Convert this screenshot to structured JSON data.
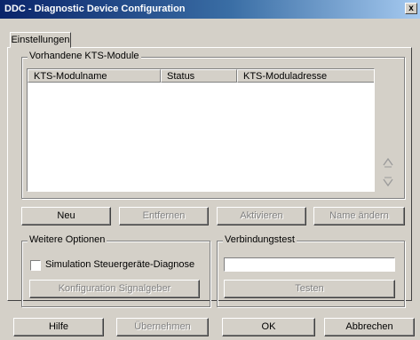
{
  "window": {
    "title": "DDC - Diagnostic Device Configuration",
    "close_label": "x"
  },
  "tabs": [
    {
      "label": "Einstellungen"
    }
  ],
  "modules_group": {
    "label": "Vorhandene KTS-Module",
    "columns": [
      "KTS-Modulname",
      "Status",
      "KTS-Moduladresse"
    ],
    "rows": []
  },
  "module_buttons": {
    "new": "Neu",
    "remove": "Entfernen",
    "activate": "Aktivieren",
    "rename": "Name ändern"
  },
  "options_group": {
    "label": "Weitere Optionen",
    "checkbox_label": "Simulation Steuergeräte-Diagnose",
    "checkbox_checked": false,
    "signal_button": "Konfiguration Signalgeber"
  },
  "connection_group": {
    "label": "Verbindungstest",
    "field_value": "",
    "test_button": "Testen"
  },
  "footer_buttons": {
    "help": "Hilfe",
    "apply": "Übernehmen",
    "ok": "OK",
    "cancel": "Abbrechen"
  },
  "icons": {
    "up": "chevron-up-icon",
    "down": "chevron-down-icon"
  }
}
